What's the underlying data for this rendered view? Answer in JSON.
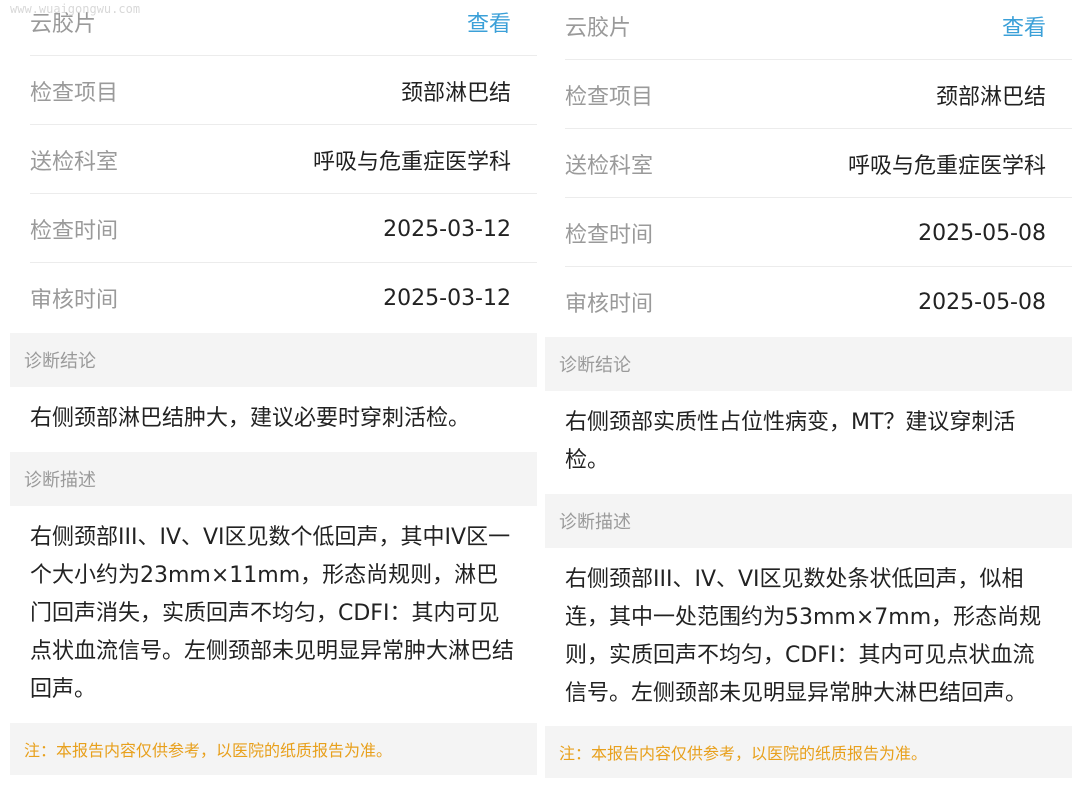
{
  "watermark": "www.wuaigongwu.com",
  "left": {
    "film": {
      "label": "云胶片",
      "action": "查看"
    },
    "rows": [
      {
        "label": "检查项目",
        "value": "颈部淋巴结"
      },
      {
        "label": "送检科室",
        "value": "呼吸与危重症医学科"
      },
      {
        "label": "检查时间",
        "value": "2025-03-12"
      },
      {
        "label": "审核时间",
        "value": "2025-03-12"
      }
    ],
    "conclusion_header": "诊断结论",
    "conclusion_text": "右侧颈部淋巴结肿大，建议必要时穿刺活检。",
    "description_header": "诊断描述",
    "description_text": "右侧颈部III、IV、VI区见数个低回声，其中IV区一个大小约为23mm×11mm，形态尚规则，淋巴门回声消失，实质回声不均匀，CDFI：其内可见点状血流信号。左侧颈部未见明显异常肿大淋巴结回声。",
    "note": "注：本报告内容仅供参考，以医院的纸质报告为准。"
  },
  "right": {
    "film": {
      "label": "云胶片",
      "action": "查看"
    },
    "rows": [
      {
        "label": "检查项目",
        "value": "颈部淋巴结"
      },
      {
        "label": "送检科室",
        "value": "呼吸与危重症医学科"
      },
      {
        "label": "检查时间",
        "value": "2025-05-08"
      },
      {
        "label": "审核时间",
        "value": "2025-05-08"
      }
    ],
    "conclusion_header": "诊断结论",
    "conclusion_text": "右侧颈部实质性占位性病变，MT？建议穿刺活检。",
    "description_header": "诊断描述",
    "description_text": "右侧颈部III、IV、VI区见数处条状低回声，似相连，其中一处范围约为53mm×7mm，形态尚规则，实质回声不均匀，CDFI：其内可见点状血流信号。左侧颈部未见明显异常肿大淋巴结回声。",
    "note": "注：本报告内容仅供参考，以医院的纸质报告为准。"
  }
}
